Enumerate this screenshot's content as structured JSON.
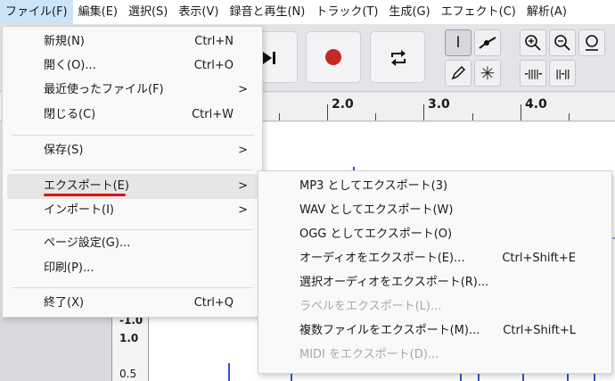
{
  "menubar": {
    "items": [
      {
        "label": "ファイル(F)"
      },
      {
        "label": "編集(E)"
      },
      {
        "label": "選択(S)"
      },
      {
        "label": "表示(V)"
      },
      {
        "label": "録音と再生(N)"
      },
      {
        "label": "トラック(T)"
      },
      {
        "label": "生成(G)"
      },
      {
        "label": "エフェクト(C)"
      },
      {
        "label": "解析(A)"
      }
    ]
  },
  "toolbar": {
    "skip_end_icon": "skip-end-icon",
    "record_icon": "record-icon",
    "loop_icon": "loop-icon",
    "tools": [
      "selection-tool-icon",
      "envelope-tool-icon",
      "draw-tool-icon",
      "multi-tool-icon",
      "zoom-in-icon",
      "zoom-out-icon",
      "zoom-fit-icon",
      "trim-icon",
      "silence-icon"
    ],
    "record_color": "#c62828"
  },
  "ruler": {
    "labels": [
      "2.0",
      "3.0",
      "4.0"
    ]
  },
  "vscale": {
    "labels": [
      "-1.0",
      "1.0",
      "0.5"
    ]
  },
  "file_menu": {
    "items": [
      {
        "label": "新規(N)",
        "shortcut": "Ctrl+N"
      },
      {
        "label": "開く(O)...",
        "shortcut": "Ctrl+O"
      },
      {
        "label": "最近使ったファイル(F)",
        "submenu": ">"
      },
      {
        "label": "閉じる(C)",
        "shortcut": "Ctrl+W"
      },
      {
        "label": "保存(S)",
        "submenu": ">"
      },
      {
        "label": "エクスポート(E)",
        "submenu": ">"
      },
      {
        "label": "インポート(I)",
        "submenu": ">"
      },
      {
        "label": "ページ設定(G)..."
      },
      {
        "label": "印刷(P)..."
      },
      {
        "label": "終了(X)",
        "shortcut": "Ctrl+Q"
      }
    ]
  },
  "export_menu": {
    "items": [
      {
        "label": "MP3 としてエクスポート(3)"
      },
      {
        "label": "WAV としてエクスポート(W)"
      },
      {
        "label": "OGG としてエクスポート(O)"
      },
      {
        "label": "オーディオをエクスポート(E)...",
        "shortcut": "Ctrl+Shift+E"
      },
      {
        "label": "選択オーディオをエクスポート(R)..."
      },
      {
        "label": "ラベルをエクスポート(L)...",
        "disabled": true
      },
      {
        "label": "複数ファイルをエクスポート(M)...",
        "shortcut": "Ctrl+Shift+L"
      },
      {
        "label": "MIDI をエクスポート(D)...",
        "disabled": true
      }
    ]
  },
  "colors": {
    "menu_highlight": "#cce4f7",
    "underline": "#dd1111",
    "waveform": "#3a4fd0"
  }
}
